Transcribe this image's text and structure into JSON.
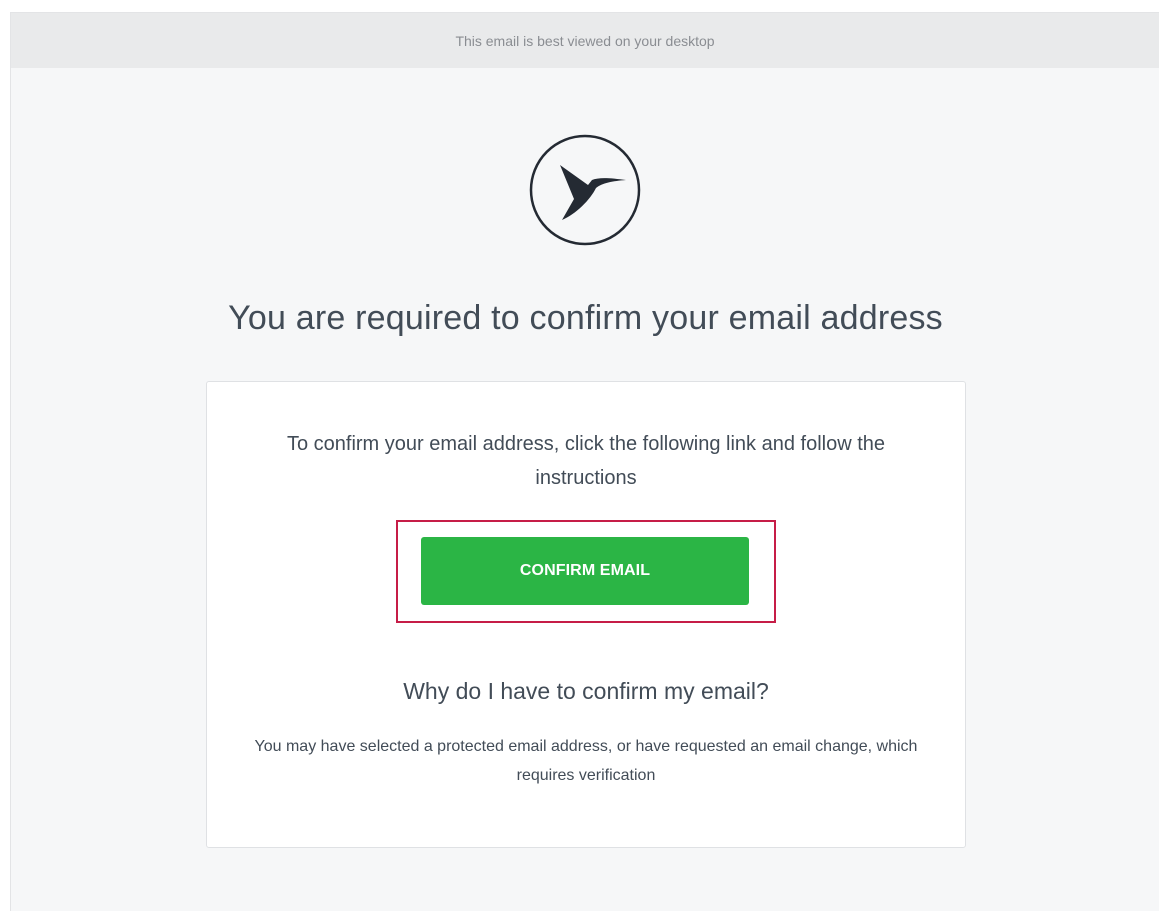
{
  "banner": {
    "text": "This email is best viewed on your desktop"
  },
  "logo": {
    "icon": "hummingbird-logo-icon"
  },
  "header": {
    "title": "You are required to confirm your email address"
  },
  "card": {
    "instructions": "To confirm your email address, click the following link and follow the instructions",
    "button_label": "CONFIRM EMAIL",
    "why_heading": "Why do I have to confirm my email?",
    "why_body": "You may have selected a protected email address, or have requested an email change, which requires verification"
  },
  "colors": {
    "button_green": "#2bb545",
    "highlight_red": "#c61d47",
    "text_dark": "#424c57",
    "banner_gray": "#e9eaeb"
  }
}
